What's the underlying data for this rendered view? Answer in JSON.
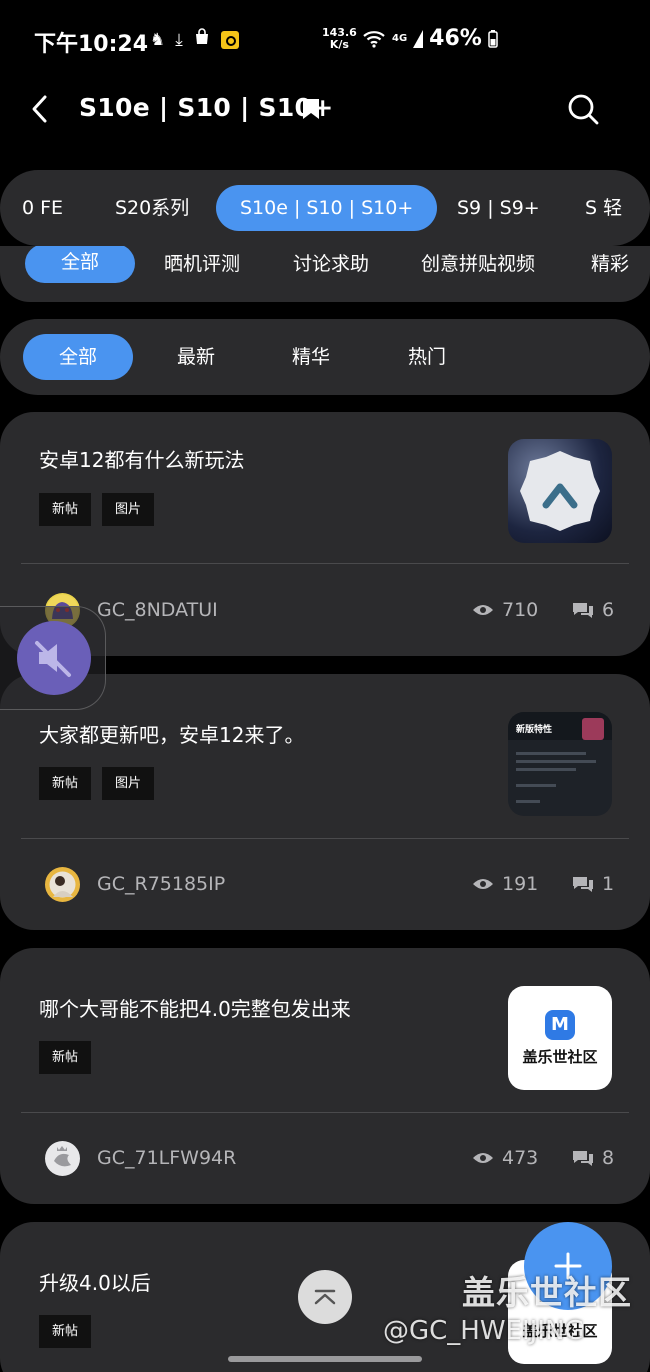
{
  "status": {
    "time": "下午10:24",
    "speed_value": "143.6",
    "speed_unit": "K/s",
    "network": "4G",
    "battery": "46%"
  },
  "header": {
    "title": "S10e | S10 | S10+"
  },
  "device_tabs": [
    "0 FE",
    "S20系列",
    "S10e | S10 | S10+",
    "S9 | S9+",
    "S 轻"
  ],
  "category_tabs": [
    "全部",
    "晒机评测",
    "讨论求助",
    "创意拼贴视频",
    "精彩"
  ],
  "sort_tabs": [
    "全部",
    "最新",
    "精华",
    "热门"
  ],
  "posts": [
    {
      "title": "安卓12都有什么新玩法",
      "tags": [
        "新帖",
        "图片"
      ],
      "user": "GC_8NDATUI",
      "views": "710",
      "comments": "6"
    },
    {
      "title": "大家都更新吧，安卓12来了。",
      "tags": [
        "新帖",
        "图片"
      ],
      "user": "GC_R75185IP",
      "views": "191",
      "comments": "1"
    },
    {
      "title": "哪个大哥能不能把4.0完整包发出来",
      "tags": [
        "新帖"
      ],
      "user": "GC_71LFW94R",
      "views": "473",
      "comments": "8",
      "thumb_text": "盖乐世社区"
    },
    {
      "title": "升级4.0以后",
      "tags": [
        "新帖"
      ],
      "thumb_text": "盖乐世社区"
    }
  ],
  "thumb2": {
    "heading": "新版特性"
  },
  "watermark": {
    "line1": "盖乐世社区",
    "line2": "@GC_HWEIJING"
  },
  "colors": {
    "accent": "#4a94f0",
    "card": "#2b2b2d",
    "background": "#000000"
  }
}
